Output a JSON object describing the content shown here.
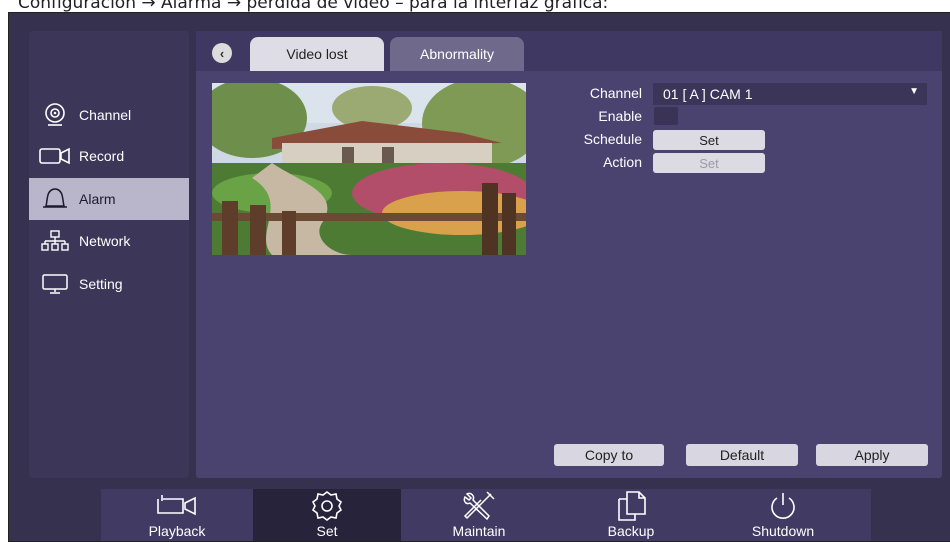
{
  "caption": "Configuración → Alarma → pérdida de vídeo – para la interfaz gráfica:",
  "sidebar": {
    "items": [
      {
        "label": "Channel",
        "icon": "camera-icon"
      },
      {
        "label": "Record",
        "icon": "record-icon"
      },
      {
        "label": "Alarm",
        "icon": "bell-icon",
        "active": true
      },
      {
        "label": "Network",
        "icon": "network-icon"
      },
      {
        "label": "Setting",
        "icon": "monitor-icon"
      }
    ]
  },
  "tabs": [
    {
      "label": "Video lost",
      "active": true
    },
    {
      "label": "Abnormality",
      "active": false
    }
  ],
  "form": {
    "channel_label": "Channel",
    "channel_value": "01 [ A ] CAM 1",
    "enable_label": "Enable",
    "schedule_label": "Schedule",
    "schedule_button": "Set",
    "action_label": "Action",
    "action_button": "Set"
  },
  "buttons": {
    "copy_to": "Copy to",
    "default": "Default",
    "apply": "Apply"
  },
  "dock": [
    {
      "label": "Playback",
      "icon": "camera-icon"
    },
    {
      "label": "Set",
      "icon": "gear-icon",
      "active": true
    },
    {
      "label": "Maintain",
      "icon": "tools-icon"
    },
    {
      "label": "Backup",
      "icon": "copy-icon"
    },
    {
      "label": "Shutdown",
      "icon": "power-icon"
    }
  ],
  "colors": {
    "background": "#35314f",
    "panel": "#4a4370",
    "active_sidebar": "#b9b6cc",
    "button": "#d8d7e1"
  }
}
